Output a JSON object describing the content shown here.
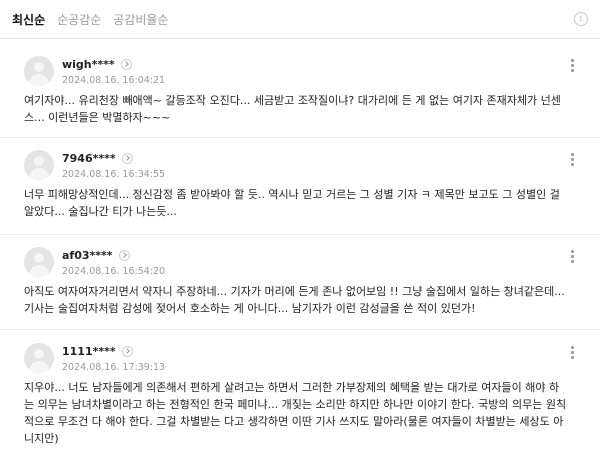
{
  "sort_tabs": [
    "최신순",
    "순공감순",
    "공감비율순"
  ],
  "info_icon_glyph": "i",
  "comments": [
    {
      "author": "wigh****",
      "date": "2024.08.16. 16:04:21",
      "text": "여기자야... 유리천장 빼애액~ 갈등조작 오진다... 세금받고 조작질이냐? 대가리에 든 게 없는 여기자 존재자체가 넌센스... 이런년들은 박멸하자~~~"
    },
    {
      "author": "7946****",
      "date": "2024.08.16. 16:34:55",
      "text": "너무 피해망상적인데... 정신감정 좀 받아봐야 할 듯.. 역시나 믿고 거르는 그 성별 기자 ㅋ 제목만 보고도 그 성별인 걸 알았다... 술집나간 티가 나는듯..."
    },
    {
      "author": "af03****",
      "date": "2024.08.16. 16:54:20",
      "text": "아직도 여자여자거리면서 약자니 주장하네... 기자가 머리에 든게 존나 없어보임 !! 그냥 술집에서 일하는 창녀같은데... 기사는 술집여자처럼 감성에 젖어서 호소하는 게 아니다... 남기자가 이런 감성글을 쓴 적이 있던가!"
    },
    {
      "author": "1111****",
      "date": "2024.08.16. 17:39:13",
      "text": "지우야... 너도 남자들에게 의존해서 편하게 살려고는 하면서 그러한 가부장제의 혜택을 받는 대가로 여자들이 해야 하는 의무는 남녀차별이라고 하는 전형적인 한국 페미냐... 개짖는 소리만 하지만 하나만 이야기 한다. 국방의 의무는 원칙적으로 무조건 다 해야 한다. 그걸 차별받는 다고 생각하면 이딴 기사 쓰지도 말아라(물론 여자들이 차별받는 세상도 아니지만)"
    }
  ]
}
